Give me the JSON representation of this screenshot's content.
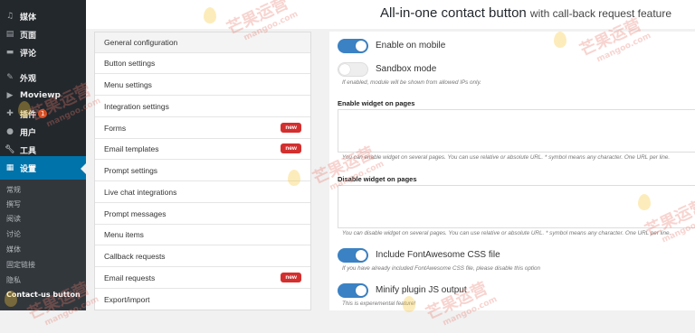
{
  "sidebar": {
    "items": [
      {
        "label": "媒体",
        "icon": "media-icon"
      },
      {
        "label": "页面",
        "icon": "page-icon"
      },
      {
        "label": "评论",
        "icon": "comment-icon"
      },
      {
        "label": "外观",
        "icon": "brush-icon"
      },
      {
        "label": "Moviewp",
        "icon": "play-icon"
      },
      {
        "label": "插件",
        "icon": "plugin-icon",
        "badge": "1"
      },
      {
        "label": "用户",
        "icon": "user-icon"
      },
      {
        "label": "工具",
        "icon": "wrench-icon"
      },
      {
        "label": "设置",
        "icon": "settings-icon"
      }
    ],
    "submenu": [
      "常规",
      "撰写",
      "阅读",
      "讨论",
      "媒体",
      "固定链接",
      "隐私",
      "Contact-us button"
    ]
  },
  "page": {
    "title": "All-in-one contact button",
    "subtitle": "with call-back request feature"
  },
  "nav": {
    "items": [
      {
        "label": "General configuration"
      },
      {
        "label": "Button settings"
      },
      {
        "label": "Menu settings"
      },
      {
        "label": "Integration settings"
      },
      {
        "label": "Forms",
        "badge": "new"
      },
      {
        "label": "Email templates",
        "badge": "new"
      },
      {
        "label": "Prompt settings"
      },
      {
        "label": "Live chat integrations"
      },
      {
        "label": "Prompt messages"
      },
      {
        "label": "Menu items"
      },
      {
        "label": "Callback requests"
      },
      {
        "label": "Email requests",
        "badge": "new"
      },
      {
        "label": "Export/import"
      }
    ]
  },
  "settings": {
    "enable_mobile": {
      "label": "Enable on mobile",
      "on": true
    },
    "sandbox": {
      "label": "Sandbox mode",
      "on": false,
      "help": "If enabled, module will be shown from allowed IPs only."
    },
    "enable_pages": {
      "label": "Enable widget on pages",
      "help": "You can enable widget on several pages. You can use relative or absolute URL. * symbol means any character. One URL per line."
    },
    "disable_pages": {
      "label": "Disable widget on pages",
      "help": "You can disable widget on several pages. You can use relative or absolute URL. * symbol means any character. One URL per line."
    },
    "fontawesome": {
      "label": "Include FontAwesome CSS file",
      "on": true,
      "help": "If you have already included FontAwesome CSS file, please disable this option"
    },
    "minify": {
      "label": "Minify plugin JS output",
      "on": true,
      "help": "This is experemental feature!"
    }
  },
  "watermark": {
    "text": "芒果运营",
    "domain": "mangoo.com"
  },
  "colors": {
    "admin_bar": "#23282d",
    "active": "#0073aa",
    "toggle_on": "#3b82c4",
    "badge_new": "#d32f2f"
  }
}
